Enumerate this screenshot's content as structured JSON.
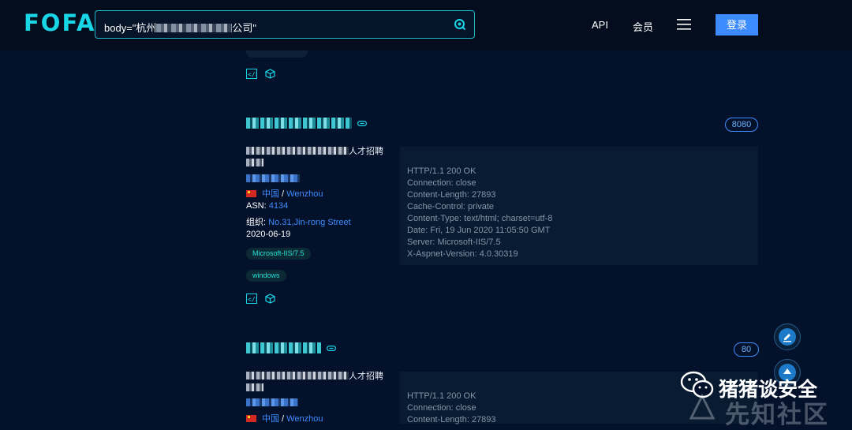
{
  "header": {
    "logo": "FOFA",
    "search_value": "body=\"杭州",
    "search_suffix": "公司\"",
    "nav_api": "API",
    "nav_vip": "会员",
    "login_label": "登录"
  },
  "results": [
    {
      "port": "8080",
      "title_suffix": "人才招聘",
      "country": "中国",
      "city": "Wenzhou",
      "asn_label": "ASN:",
      "asn": "4134",
      "org_label": "组织:",
      "org": "No.31,Jin-rong Street",
      "date": "2020-06-19",
      "tags": [
        "Microsoft-IIS/7.5",
        "windows"
      ],
      "headers": [
        "HTTP/1.1 200 OK",
        "Connection: close",
        "Content-Length: 27893",
        "Cache-Control: private",
        "Content-Type: text/html; charset=utf-8",
        "Date: Fri, 19 Jun 2020 11:05:50 GMT",
        "Server: Microsoft-IIS/7.5",
        "X-Aspnet-Version: 4.0.30319"
      ]
    },
    {
      "port": "80",
      "title_suffix": "人才招聘",
      "country": "中国",
      "city": "Wenzhou",
      "headers": [
        "HTTP/1.1 200 OK",
        "Connection: close",
        "Content-Length: 27893"
      ]
    }
  ],
  "watermark": {
    "wechat_name": "猪猪谈安全",
    "site": "先知社区"
  },
  "colors": {
    "background": "#04112a",
    "accent_cyan": "#19d6e6",
    "link_blue": "#3e8cff",
    "login_button": "#3c8cff"
  }
}
